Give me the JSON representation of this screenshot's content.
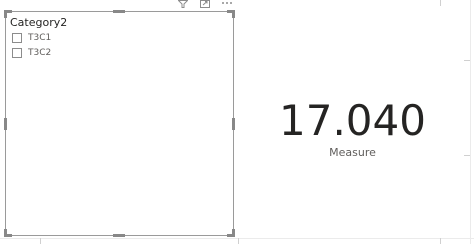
{
  "slicer": {
    "title": "Category2",
    "items": [
      {
        "label": "T3C1",
        "checked": false
      },
      {
        "label": "T3C2",
        "checked": false
      }
    ]
  },
  "header_icons": [
    "filter-icon",
    "focus-mode-icon",
    "more-options-icon"
  ],
  "card": {
    "value": "17.040",
    "label": "Measure"
  }
}
